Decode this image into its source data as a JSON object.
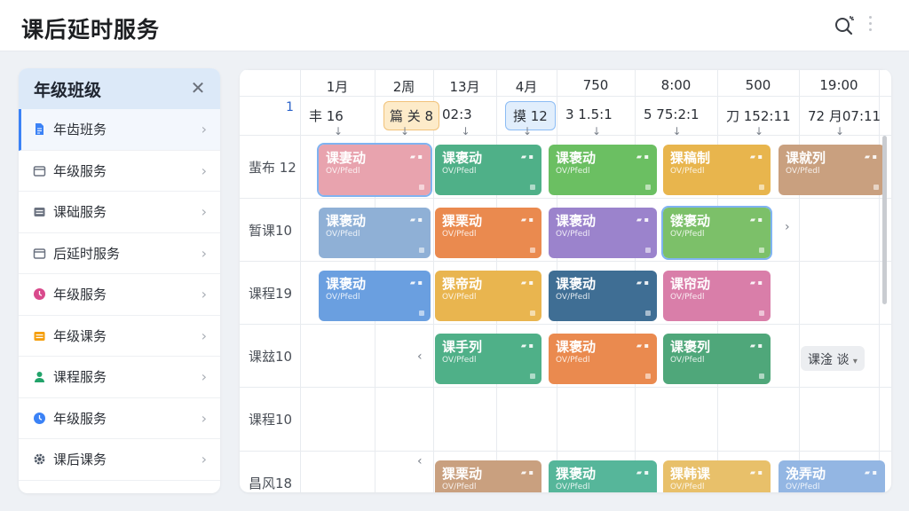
{
  "app": {
    "title": "课后延时服务"
  },
  "sidebar": {
    "title": "年级班级",
    "items": [
      {
        "label": "年齿班务",
        "icon": "document-icon",
        "color": "#3b82f6"
      },
      {
        "label": "年级服务",
        "icon": "folder-icon",
        "color": "#6b7280"
      },
      {
        "label": "课础服务",
        "icon": "list-icon",
        "color": "#6b7280"
      },
      {
        "label": "后延时服务",
        "icon": "folder-icon",
        "color": "#6b7280"
      },
      {
        "label": "年级服务",
        "icon": "clock-icon",
        "color": "#d94a8c"
      },
      {
        "label": "年级课务",
        "icon": "list-icon",
        "color": "#f59e0b"
      },
      {
        "label": "课程服务",
        "icon": "user-icon",
        "color": "#22a36a"
      },
      {
        "label": "年级服务",
        "icon": "clock-icon",
        "color": "#3b82f6"
      },
      {
        "label": "课后课务",
        "icon": "gear-icon",
        "color": "#4b5563"
      }
    ]
  },
  "schedule": {
    "corner": "1",
    "columns": [
      {
        "head": "1月",
        "sub": "丰 16"
      },
      {
        "head": "2周",
        "sub": "篇 关 8"
      },
      {
        "head": "13月",
        "sub": "02:3"
      },
      {
        "head": "4月",
        "sub": "摸 12"
      },
      {
        "head": "750",
        "sub": "3 1.5:1"
      },
      {
        "head": "8:00",
        "sub": "5 75:2:1"
      },
      {
        "head": "500",
        "sub": "刀 152:11"
      },
      {
        "head": "19:00",
        "sub": "72 月07:11"
      }
    ],
    "rows": [
      {
        "label": "蜚布 12"
      },
      {
        "label": "暂课10"
      },
      {
        "label": "课程19"
      },
      {
        "label": "课玆10"
      },
      {
        "label": "课程10"
      },
      {
        "label": "昌风18"
      }
    ],
    "cards": [
      {
        "title": "课妻动",
        "sub": "OV/Pfedl",
        "color": "#e8a3ae"
      },
      {
        "title": "课褒动",
        "sub": "OV/Pfedl",
        "color": "#4fb088"
      },
      {
        "title": "课褒动",
        "sub": "OV/Pfedl",
        "color": "#6bbf62"
      },
      {
        "title": "猓稿制",
        "sub": "OV/Pfedl",
        "color": "#e8b54d"
      },
      {
        "title": "课就列",
        "sub": "OV/Pfedl",
        "color": "#c9a07f"
      },
      {
        "title": "课褒动",
        "sub": "OV/Pfedl",
        "color": "#8fb0d6"
      },
      {
        "title": "猓栗动",
        "sub": "OV/Pfedl",
        "color": "#ea8a4f"
      },
      {
        "title": "课褒动",
        "sub": "OV/Pfedl",
        "color": "#9b83cc"
      },
      {
        "title": "镂褒动",
        "sub": "OV/Pfedl",
        "color": "#7cc069"
      },
      {
        "title": "课褒动",
        "sub": "OV/Pfedl",
        "color": "#6a9fe0"
      },
      {
        "title": "猓帝动",
        "sub": "OV/Pfedl",
        "color": "#e9b54f"
      },
      {
        "title": "课褒动",
        "sub": "OV/Pfedl",
        "color": "#3f6e94"
      },
      {
        "title": "课帘动",
        "sub": "OV/Pfedl",
        "color": "#d97ea9"
      },
      {
        "title": "课手列",
        "sub": "OV/Pfedl",
        "color": "#4fb088"
      },
      {
        "title": "课褒动",
        "sub": "OV/Pfedl",
        "color": "#ea8a4f"
      },
      {
        "title": "课褒列",
        "sub": "OV/Pfedl",
        "color": "#4fa77a"
      },
      {
        "title": "猓栗动",
        "sub": "OV/Pfedl",
        "color": "#c9a07f"
      },
      {
        "title": "猓褒动",
        "sub": "OV/Pfedl",
        "color": "#56b69a"
      },
      {
        "title": "猓韩课",
        "sub": "OV/Pfedl",
        "color": "#e8c06a"
      },
      {
        "title": "浼弄动",
        "sub": "OV/Pfedl",
        "color": "#93b6e3"
      }
    ],
    "pill": "课淦 谈"
  }
}
